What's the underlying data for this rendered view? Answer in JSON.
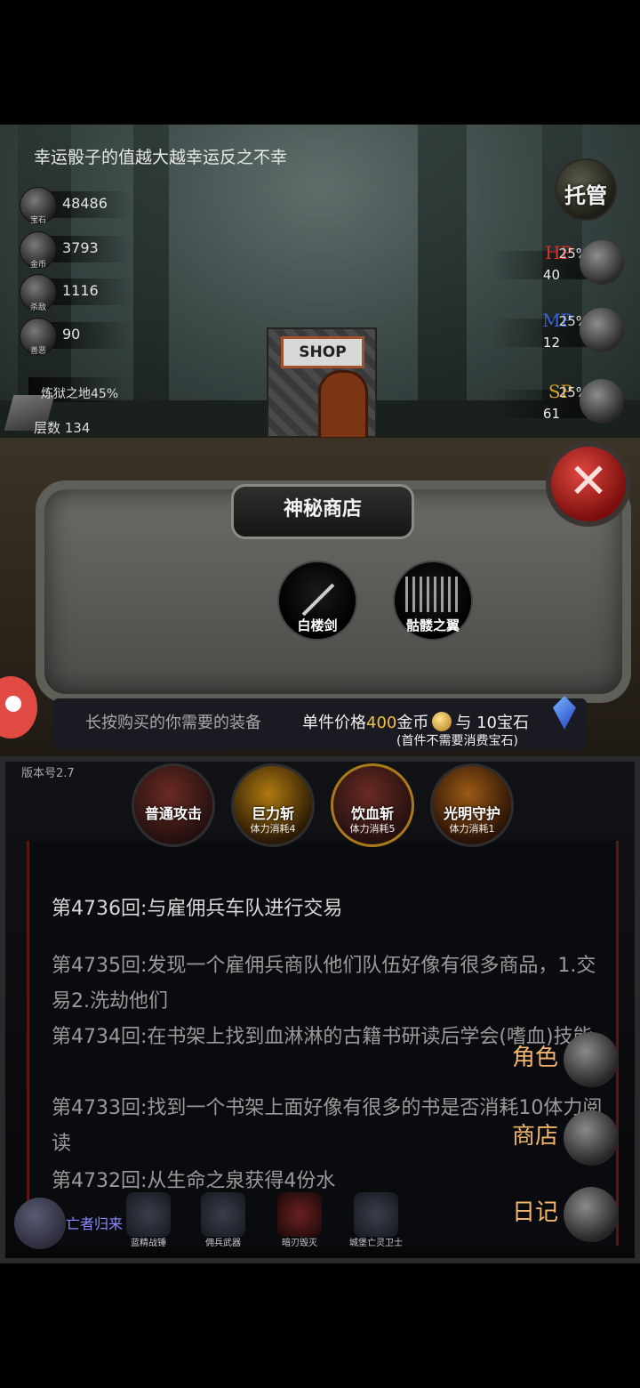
{
  "tip": "幸运骰子的值越大越幸运反之不幸",
  "resources": [
    {
      "label": "宝石",
      "value": "48486",
      "icon": "gem-icon"
    },
    {
      "label": "金币",
      "value": "3793",
      "icon": "coin-icon"
    },
    {
      "label": "杀敌",
      "value": "1116",
      "icon": "skull-icon"
    },
    {
      "label": "善恶",
      "value": "90",
      "icon": "mask-icon"
    }
  ],
  "floor": {
    "zone": "炼狱之地45%",
    "level": "层数 134"
  },
  "auto_button": "托管",
  "stats": [
    {
      "label": "HP",
      "pct": "25%",
      "value": "40",
      "color": "#e0302a"
    },
    {
      "label": "MP",
      "pct": "25%",
      "value": "12",
      "color": "#3a60e0"
    },
    {
      "label": "SP",
      "pct": "25%",
      "value": "61",
      "color": "#e0a020"
    }
  ],
  "shop_sign": "SHOP",
  "shop": {
    "title": "神秘商店",
    "items": [
      "白楼剑",
      "骷髅之翼"
    ],
    "hint": "长按购买的你需要的装备",
    "price_prefix": "单件价格",
    "price_num": "400",
    "price_coin": "金币",
    "price_gem": "与 10宝石",
    "gem_note": "(首件不需要消费宝石)"
  },
  "version": "版本号2.7",
  "skills": [
    {
      "name": "普通攻击",
      "cost": ""
    },
    {
      "name": "巨力斩",
      "cost": "体力消耗4"
    },
    {
      "name": "饮血斩",
      "cost": "体力消耗5"
    },
    {
      "name": "光明守护",
      "cost": "体力消耗1"
    }
  ],
  "log": [
    "第4736回:与雇佣兵车队进行交易",
    "第4735回:发现一个雇佣兵商队他们队伍好像有很多商品，1.交易2.洗劫他们",
    "第4734回:在书架上找到血淋淋的古籍书研读后学会(嗜血)技能",
    "第4733回:找到一个书架上面好像有很多的书是否消耗10体力阅读",
    "第4732回:从生命之泉获得4份水"
  ],
  "side_menu": [
    "角色",
    "商店",
    "日记"
  ],
  "undead_label": "亡者归来",
  "mercenaries": [
    "蓝精战锤",
    "佣兵武器",
    "暗刃毁灭",
    "城堡亡灵卫士"
  ]
}
